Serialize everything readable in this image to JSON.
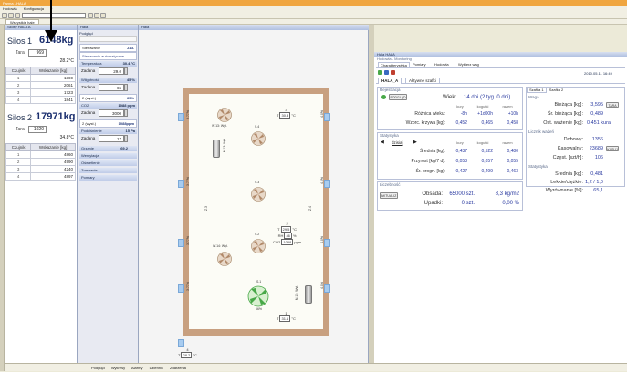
{
  "app": {
    "title": "Farma - HALA",
    "menu": [
      "Hodowla",
      "Konfiguracja",
      "?"
    ],
    "tab": "Wszystkie hale"
  },
  "toolbar": {
    "select_value": ""
  },
  "silo_panel": {
    "header": "Silosy HALA A",
    "silos": [
      {
        "name": "Silos 1",
        "weight": "6148kg",
        "tara_label": "Tara",
        "tara": "969",
        "temp": "28.2°C",
        "table_headers": [
          "Czujnik",
          "Wskazanie [kg]"
        ],
        "rows": [
          [
            "1",
            "1369"
          ],
          [
            "2",
            "2061"
          ],
          [
            "3",
            "1723"
          ],
          [
            "4",
            "1841"
          ]
        ]
      },
      {
        "name": "Silos 2",
        "weight": "17971kg",
        "tara_label": "Tara",
        "tara": "1020",
        "temp": "34.8°C",
        "table_headers": [
          "Czujnik",
          "Wskazanie [kg]"
        ],
        "rows": [
          [
            "1",
            "4860"
          ],
          [
            "2",
            "4990"
          ],
          [
            "3",
            "4240"
          ],
          [
            "4",
            "4897"
          ]
        ]
      }
    ]
  },
  "control_panel": {
    "header": "Hala",
    "subheader": "Podgląd",
    "sections": [
      {
        "label": "Sterowanie",
        "value": "ZAŁ"
      },
      {
        "label": "Sterowanie automatyczne",
        "value": ""
      },
      {
        "label": "Temperatura",
        "value": "30.4 °C"
      },
      {
        "label": "Zadana",
        "value": "29.0"
      },
      {
        "label": "Wilgotność",
        "value": "45 %"
      },
      {
        "label": "Zadana",
        "value": "65"
      },
      {
        "label": "2 (wyst.)",
        "value": "65%"
      },
      {
        "label": "CO2",
        "value": "1088 ppm"
      },
      {
        "label": "Zadana",
        "value": "3000"
      },
      {
        "label": "2 (wyst.)",
        "value": "1088ppm"
      },
      {
        "label": "Podciśnienie",
        "value": "15 Pa"
      },
      {
        "label": "Zadana",
        "value": "17"
      },
      {
        "label": "Grzanie",
        "value": "69.2"
      },
      {
        "label": "Wentylacja",
        "value": ""
      },
      {
        "label": "Oświetlenie",
        "value": ""
      },
      {
        "label": "Zraszanie",
        "value": ""
      },
      {
        "label": "Pomiary",
        "value": ""
      }
    ]
  },
  "barn": {
    "header": "Hala",
    "fans": [
      {
        "label": "W.13: Wył."
      },
      {
        "label": "S.4"
      },
      {
        "label": "S.3"
      },
      {
        "label": "W.14: Wył."
      },
      {
        "label": "S.2"
      },
      {
        "label": "S.1",
        "level": "66%"
      }
    ],
    "side_labels": [
      "3.77%",
      "4.0%",
      "4.0%",
      "3.77%",
      "3.77%",
      "4.0%",
      "Z.3",
      "Z.4",
      "4.0%",
      "3.77%"
    ],
    "sensors": [
      {
        "id": "3",
        "temp": "30.3"
      },
      {
        "id": "2",
        "temp": "29.5",
        "rh": "46",
        "co2": "1088"
      },
      {
        "id": "1",
        "temp": "31.1"
      },
      {
        "id": "4",
        "temp": "28.2"
      }
    ],
    "cylinder_labels": [
      "N.13: Wył.",
      "N.15: Wył."
    ]
  },
  "bottom_tabs": [
    "Podgląd",
    "Wykresy",
    "Alarmy",
    "Dziennik",
    "Zdarzenia"
  ],
  "right_panel": {
    "header": "Hala HALA",
    "subheader": "Hodowla - Monitoring",
    "tabs": [
      "Charakterystyka",
      "Pomiary",
      "Hodowla",
      "Wybierz wag"
    ],
    "date": "2010.05.11 16:49",
    "hall_tab": "HALA_A",
    "hall_name": "Aktywne szafki",
    "registration": {
      "label": "Rejestracja",
      "button": "PODGLĄD",
      "age_label": "Wiek:",
      "age": "14 dni (2 tyg. 0 dni)",
      "col_headers": [
        "kury",
        "kogutki",
        "razem"
      ],
      "rows": [
        {
          "label": "Różnica wieku:",
          "values": [
            "-8h",
            "+1d00h",
            "+10h"
          ]
        },
        {
          "label": "Wzorc. krzywa [kg]:",
          "values": [
            "0,452",
            "0,465",
            "0,458"
          ]
        }
      ]
    },
    "stats": {
      "label": "Statystyka",
      "nav_label": "dzisiaj",
      "col_headers": [
        "kury",
        "kogutki",
        "razem"
      ],
      "rows": [
        {
          "label": "Średnia [kg]:",
          "values": [
            "0,437",
            "0,522",
            "0,480"
          ]
        },
        {
          "label": "Przyrost [kg/7 d]:",
          "values": [
            "0,053",
            "0,057",
            "0,055"
          ]
        },
        {
          "label": "Śr. progn. [kg]:",
          "values": [
            "0,427",
            "0,499",
            "0,463"
          ]
        }
      ]
    },
    "count": {
      "label": "Liczebność",
      "button": "AKTUALIZ",
      "rows": [
        {
          "label": "Obsada:",
          "v1": "65000 szt.",
          "v2": "8,3 kg/m2"
        },
        {
          "label": "Upadki:",
          "v1": "0 szt.",
          "v2": "0,00 %"
        }
      ]
    },
    "scale": {
      "tabs": [
        "Szafka 1",
        "Szafka 2"
      ],
      "waga_label": "Waga",
      "rows": [
        {
          "label": "Bieżąca [kg]:",
          "value": "3,595",
          "btn": "TARA"
        },
        {
          "label": "Śr. bieżąca [kg]:",
          "value": "0,489"
        },
        {
          "label": "Ost. ważenie [kg]:",
          "value": "0,451 kura"
        }
      ],
      "counter_label": "Licznik ważeń",
      "counter_rows": [
        {
          "label": "Dobowy:",
          "value": "1356"
        },
        {
          "label": "Kasowalny:",
          "value": "23689",
          "btn": "KASUJ"
        },
        {
          "label": "Częst. [szt/h]:",
          "value": "106"
        }
      ],
      "stats_label": "Statystyka",
      "stats_rows": [
        {
          "label": "Średnia [kg]:",
          "value": "0,481"
        },
        {
          "label": "Lekkie/ciężkie:",
          "value": "1,2 / 1,0"
        },
        {
          "label": "Wyrównanie [%]:",
          "value": "65,1"
        }
      ]
    }
  },
  "colors": {
    "accent": "#f0a640",
    "value_blue": "#2a3aa0",
    "barn_wall": "#c8a080",
    "fan_active": "#48a848"
  }
}
